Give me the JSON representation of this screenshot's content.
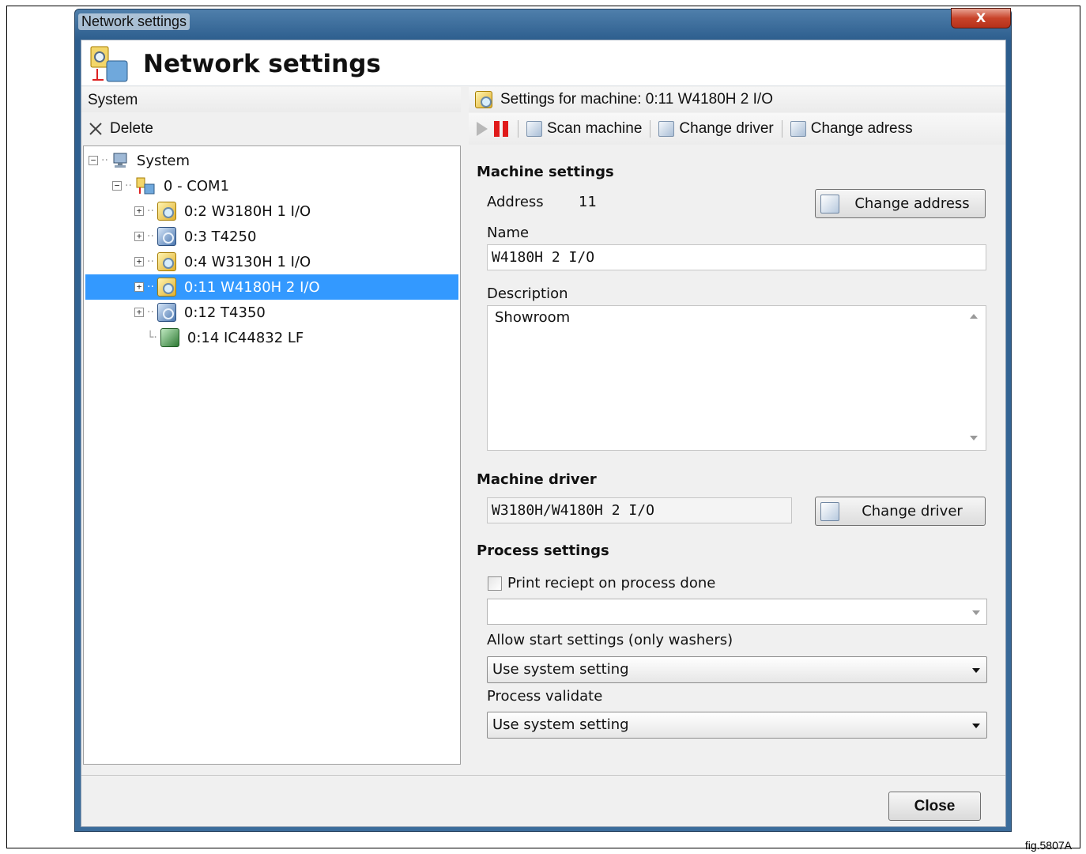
{
  "window": {
    "title": "Network settings",
    "close_glyph": "X"
  },
  "header": {
    "title": "Network settings",
    "icon": "network-settings-icon"
  },
  "left_pane": {
    "header": "System",
    "toolbar": {
      "delete_label": "Delete",
      "delete_icon": "close-icon"
    },
    "tree": {
      "root_label": "System",
      "port_label": "0 - COM1",
      "items": [
        {
          "label": "0:2 W3180H 1 I/O",
          "icon": "washer-icon",
          "expandable": true
        },
        {
          "label": "0:3 T4250",
          "icon": "dryer-icon",
          "expandable": true
        },
        {
          "label": "0:4 W3130H 1 I/O",
          "icon": "washer-icon",
          "expandable": true
        },
        {
          "label": "0:11 W4180H 2 I/O",
          "icon": "washer-icon",
          "expandable": true,
          "selected": true
        },
        {
          "label": "0:12 T4350",
          "icon": "dryer-icon",
          "expandable": true
        },
        {
          "label": "0:14 IC44832 LF",
          "icon": "ironer-icon",
          "expandable": false
        }
      ]
    }
  },
  "right_pane": {
    "header": "Settings for machine: 0:11 W4180H 2 I/O",
    "toolbar": {
      "scan_label": "Scan machine",
      "change_driver_label": "Change driver",
      "change_address_label": "Change adress"
    },
    "machine_settings": {
      "title": "Machine settings",
      "address_label": "Address",
      "address_value": "11",
      "change_address_button": "Change address",
      "name_label": "Name",
      "name_value": "W4180H 2 I/O",
      "description_label": "Description",
      "description_value": "Showroom"
    },
    "machine_driver": {
      "title": "Machine driver",
      "driver_value": "W3180H/W4180H 2 I/O",
      "change_driver_button": "Change driver"
    },
    "process_settings": {
      "title": "Process settings",
      "print_receipt_label": "Print reciept on process done",
      "print_receipt_checked": false,
      "printer_value": "",
      "allow_start_label": "Allow start settings (only washers)",
      "allow_start_value": "Use system setting",
      "process_validate_label": "Process validate",
      "process_validate_value": "Use system setting"
    }
  },
  "footer": {
    "close_label": "Close"
  },
  "figure_label": "fig.5807A",
  "colors": {
    "selection": "#3399ff",
    "pause_red": "#e01b1b",
    "title_bar": "#2c5d8d"
  }
}
